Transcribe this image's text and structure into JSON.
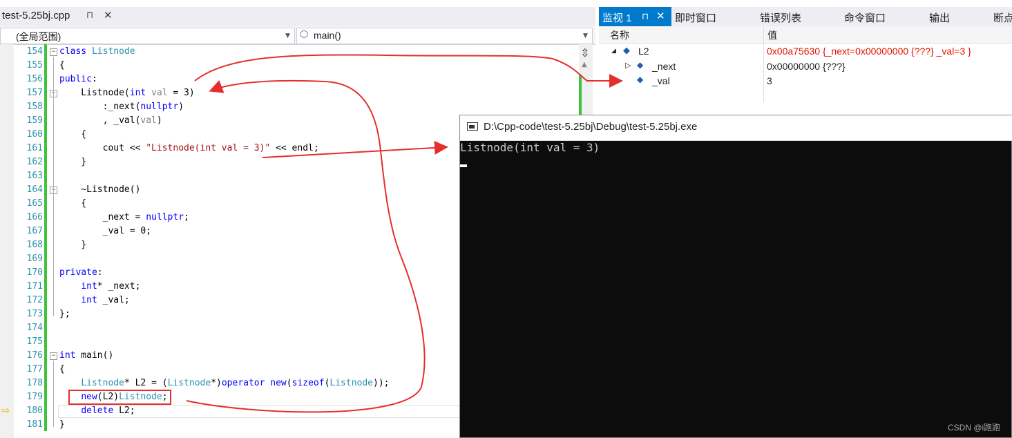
{
  "editor": {
    "tab_label": "test-5.25bj.cpp",
    "tab_pin": "⊓",
    "tab_close": "✕",
    "scope": "(全局范围)",
    "function": "main()"
  },
  "code_lines": [
    {
      "n": "154",
      "fold": "−",
      "segs": [
        [
          "kw",
          "class "
        ],
        [
          "ty",
          "Listnode"
        ]
      ]
    },
    {
      "n": "155",
      "segs": [
        [
          "",
          "{"
        ]
      ]
    },
    {
      "n": "156",
      "segs": [
        [
          "kw",
          "public"
        ],
        [
          "",
          ":"
        ]
      ]
    },
    {
      "n": "157",
      "fold": "−",
      "segs": [
        [
          "",
          "    Listnode("
        ],
        [
          "kw",
          "int"
        ],
        [
          "gr",
          " val"
        ],
        [
          "",
          " = 3)"
        ]
      ]
    },
    {
      "n": "158",
      "segs": [
        [
          "",
          "        :_next("
        ],
        [
          "kw",
          "nullptr"
        ],
        [
          "",
          ")"
        ]
      ]
    },
    {
      "n": "159",
      "segs": [
        [
          "",
          "        , _val("
        ],
        [
          "gr",
          "val"
        ],
        [
          "",
          ")"
        ]
      ]
    },
    {
      "n": "160",
      "segs": [
        [
          "",
          "    {"
        ]
      ]
    },
    {
      "n": "161",
      "segs": [
        [
          "",
          "        cout << "
        ],
        [
          "st",
          "\"Listnode(int val = 3)\""
        ],
        [
          "",
          " << endl;"
        ]
      ]
    },
    {
      "n": "162",
      "segs": [
        [
          "",
          "    }"
        ]
      ]
    },
    {
      "n": "163",
      "segs": [
        [
          "",
          ""
        ]
      ]
    },
    {
      "n": "164",
      "fold": "−",
      "segs": [
        [
          "",
          "    ~Listnode()"
        ]
      ]
    },
    {
      "n": "165",
      "segs": [
        [
          "",
          "    {"
        ]
      ]
    },
    {
      "n": "166",
      "segs": [
        [
          "",
          "        _next = "
        ],
        [
          "kw",
          "nullptr"
        ],
        [
          "",
          ";"
        ]
      ]
    },
    {
      "n": "167",
      "segs": [
        [
          "",
          "        _val = 0;"
        ]
      ]
    },
    {
      "n": "168",
      "segs": [
        [
          "",
          "    }"
        ]
      ]
    },
    {
      "n": "169",
      "segs": [
        [
          "",
          ""
        ]
      ]
    },
    {
      "n": "170",
      "segs": [
        [
          "kw",
          "private"
        ],
        [
          "",
          ":"
        ]
      ]
    },
    {
      "n": "171",
      "segs": [
        [
          "",
          "    "
        ],
        [
          "kw",
          "int"
        ],
        [
          "",
          "* _next;"
        ]
      ]
    },
    {
      "n": "172",
      "segs": [
        [
          "",
          "    "
        ],
        [
          "kw",
          "int"
        ],
        [
          "",
          " _val;"
        ]
      ]
    },
    {
      "n": "173",
      "segs": [
        [
          "",
          "};"
        ]
      ]
    },
    {
      "n": "174",
      "segs": [
        [
          "",
          ""
        ]
      ]
    },
    {
      "n": "175",
      "segs": [
        [
          "",
          ""
        ]
      ]
    },
    {
      "n": "176",
      "fold": "−",
      "segs": [
        [
          "kw",
          "int"
        ],
        [
          "",
          " main()"
        ]
      ]
    },
    {
      "n": "177",
      "segs": [
        [
          "",
          "{"
        ]
      ]
    },
    {
      "n": "178",
      "segs": [
        [
          "",
          "    "
        ],
        [
          "ty",
          "Listnode"
        ],
        [
          "",
          "* L2 = ("
        ],
        [
          "ty",
          "Listnode"
        ],
        [
          "",
          "*)"
        ],
        [
          "kw",
          "operator new"
        ],
        [
          "",
          "("
        ],
        [
          "kw",
          "sizeof"
        ],
        [
          "",
          "("
        ],
        [
          "ty",
          "Listnode"
        ],
        [
          "",
          "));"
        ]
      ]
    },
    {
      "n": "179",
      "segs": [
        [
          "",
          "    "
        ],
        [
          "kw",
          "new"
        ],
        [
          "",
          "(L2)"
        ],
        [
          "ty",
          "Listnode"
        ],
        [
          "",
          ";"
        ]
      ]
    },
    {
      "n": "180",
      "segs": [
        [
          "",
          "    "
        ],
        [
          "kw",
          "delete"
        ],
        [
          "",
          " L2;"
        ]
      ]
    },
    {
      "n": "181",
      "segs": [
        [
          "",
          "}"
        ]
      ]
    }
  ],
  "watch": {
    "tabs": [
      "监视 1",
      "即时窗口",
      "错误列表",
      "命令窗口",
      "输出",
      "断点"
    ],
    "tab_pin": "⊓",
    "tab_close": "✕",
    "col_name": "名称",
    "col_value": "值",
    "rows": [
      {
        "name": "L2",
        "value": "0x00a75630 {_next=0x00000000 {???} _val=3 }",
        "expand": "◢",
        "changed": true
      },
      {
        "name": "_next",
        "value": "0x00000000 {???}",
        "expand": "▷",
        "changed": false
      },
      {
        "name": "_val",
        "value": "3",
        "expand": "",
        "changed": false
      }
    ]
  },
  "console": {
    "title": "D:\\Cpp-code\\test-5.25bj\\Debug\\test-5.25bj.exe",
    "output": "Listnode(int val = 3)"
  },
  "watermark": "CSDN @i跑跑",
  "colors": {
    "annotation_red": "#e52e2e",
    "accent_blue": "#007acc",
    "console_bg": "#0c0c0c"
  }
}
